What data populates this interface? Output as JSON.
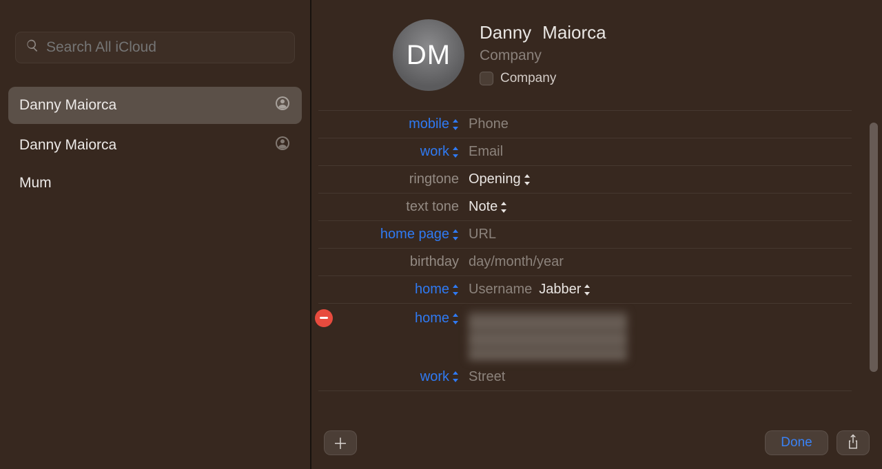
{
  "search": {
    "placeholder": "Search All iCloud"
  },
  "contacts": [
    {
      "name": "Danny  Maiorca",
      "selected": true,
      "icon": true
    },
    {
      "name": "Danny Maiorca",
      "selected": false,
      "icon": true
    },
    {
      "name": "Mum",
      "selected": false,
      "icon": false
    }
  ],
  "avatar_initials": "DM",
  "name": {
    "first": "Danny",
    "last": "Maiorca"
  },
  "company_placeholder": "Company",
  "company_checkbox_label": "Company",
  "rows": {
    "mobile_label": "mobile",
    "mobile_value": "Phone",
    "work_email_label": "work",
    "work_email_value": "Email",
    "ringtone_label": "ringtone",
    "ringtone_value": "Opening",
    "texttone_label": "text tone",
    "texttone_value": "Note",
    "homepage_label": "home page",
    "homepage_value": "URL",
    "birthday_label": "birthday",
    "birthday_value": "day/month/year",
    "im_label": "home",
    "im_value": "Username",
    "im_service": "Jabber",
    "addr_home_label": "home",
    "addr_work_label": "work",
    "addr_work_value": "Street"
  },
  "footer": {
    "done": "Done"
  }
}
